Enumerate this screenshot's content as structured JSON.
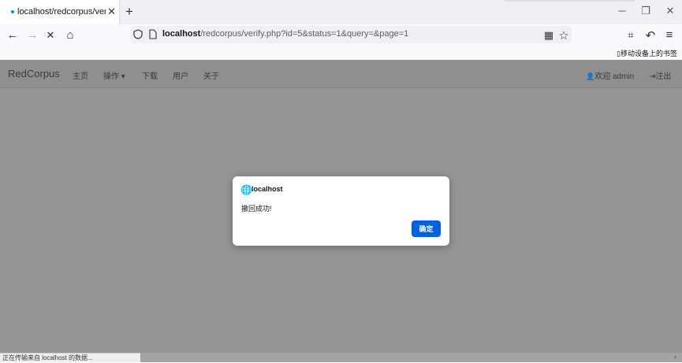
{
  "tab": {
    "title": "localhost/redcorpus/verify.pl",
    "close_glyph": "✕"
  },
  "new_tab_glyph": "+",
  "window_controls": {
    "minimize": "─",
    "restore": "❐",
    "close": "✕"
  },
  "nav": {
    "back": "←",
    "forward": "→",
    "stop": "✕",
    "home": "⌂"
  },
  "url": {
    "host": "localhost",
    "path": "/redcorpus/verify.php?id=5&status=1&query=&page=1"
  },
  "toolbar_icons": {
    "qr": "▦",
    "star": "☆",
    "crop": "⌗",
    "undo": "↶",
    "menu": "≡"
  },
  "bookmarks": {
    "mobile": "移动设备上的书签",
    "mobile_icon": "▯"
  },
  "site": {
    "brand": "RedCorpus",
    "menu": [
      "主页",
      "操作 ▾",
      "下载",
      "用户",
      "关于"
    ],
    "welcome": "欢迎 admin",
    "user_icon": "👤",
    "logout": "注出",
    "logout_icon": "⇥"
  },
  "dialog": {
    "globe_icon": "🌐",
    "origin": "localhost",
    "message": "撤回成功!",
    "ok_label": "确定"
  },
  "status_text": "正在传输来自 localhost 的数据...",
  "scroll_arrow": "›",
  "colors": {
    "accent": "#0061e0",
    "overlay": "#959595"
  }
}
